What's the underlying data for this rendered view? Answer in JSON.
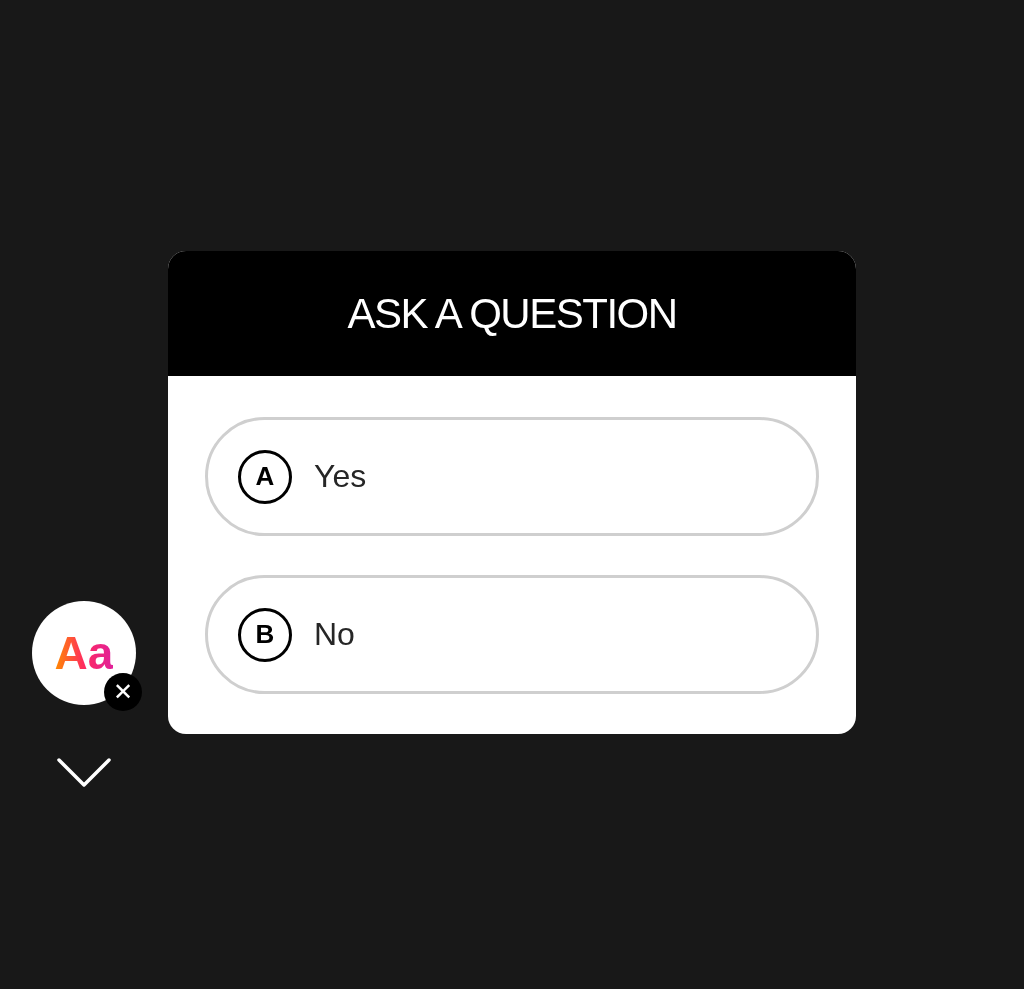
{
  "text_style_button": {
    "label": "Aa"
  },
  "remove_badge": {
    "label": "✕"
  },
  "card": {
    "title": "ASK A QUESTION",
    "options": [
      {
        "letter": "A",
        "text": "Yes"
      },
      {
        "letter": "B",
        "text": "No"
      }
    ]
  }
}
